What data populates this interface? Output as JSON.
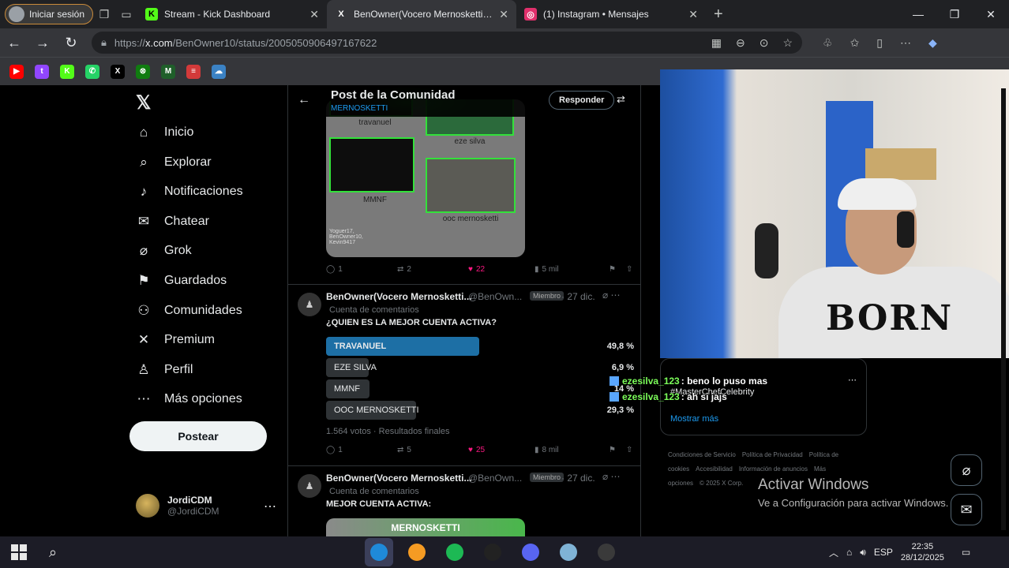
{
  "browser": {
    "profile_label": "Iniciar sesión",
    "tabs": [
      {
        "title": "Stream - Kick Dashboard",
        "icon": "kick-icon",
        "color": "#53fc18"
      },
      {
        "title": "BenOwner(Vocero Mernoskettista)",
        "icon": "x-icon",
        "color": "#000000"
      },
      {
        "title": "(1) Instagram • Mensajes",
        "icon": "instagram-icon",
        "color": "#e1306c"
      }
    ],
    "url_prefix": "https://",
    "url_host": "x.com",
    "url_path": "/BenOwner10/status/2005050906497167622",
    "bookmarks": [
      {
        "icon": "youtube-icon",
        "glyph": "▶",
        "color": "#ff0000"
      },
      {
        "icon": "twitch-icon",
        "glyph": "t",
        "color": "#9146ff"
      },
      {
        "icon": "kick-icon",
        "glyph": "K",
        "color": "#53fc18"
      },
      {
        "icon": "whatsapp-icon",
        "glyph": "✆",
        "color": "#25d366"
      },
      {
        "icon": "x-icon",
        "glyph": "X",
        "color": "#000000"
      },
      {
        "icon": "xbox-icon",
        "glyph": "⊗",
        "color": "#107c10"
      },
      {
        "icon": "m-icon",
        "glyph": "M",
        "color": "#1f5f2a"
      },
      {
        "icon": "stack-icon",
        "glyph": "≡",
        "color": "#d33a3a"
      },
      {
        "icon": "cloud-icon",
        "glyph": "☁",
        "color": "#3b82c4"
      }
    ]
  },
  "sidebar": {
    "items": [
      {
        "label": "Inicio",
        "icon": "home-icon",
        "glyph": "⌂"
      },
      {
        "label": "Explorar",
        "icon": "search-icon",
        "glyph": "⌕"
      },
      {
        "label": "Notificaciones",
        "icon": "bell-icon",
        "glyph": "♪"
      },
      {
        "label": "Chatear",
        "icon": "mail-icon",
        "glyph": "✉"
      },
      {
        "label": "Grok",
        "icon": "grok-icon",
        "glyph": "⌀"
      },
      {
        "label": "Guardados",
        "icon": "bookmark-icon",
        "glyph": "⚑"
      },
      {
        "label": "Comunidades",
        "icon": "communities-icon",
        "glyph": "⚇"
      },
      {
        "label": "Premium",
        "icon": "x-premium-icon",
        "glyph": "✕"
      },
      {
        "label": "Perfil",
        "icon": "person-icon",
        "glyph": "♙"
      },
      {
        "label": "Más opciones",
        "icon": "more-circle-icon",
        "glyph": "⋯"
      }
    ],
    "post_button": "Postear",
    "account_name": "JordiCDM",
    "account_handle": "@JordiCDM"
  },
  "header": {
    "title": "Post de la Comunidad",
    "subtitle": "MERNOSKETTI",
    "reply_button": "Responder"
  },
  "collage": {
    "captions": [
      "travanuel",
      "eze silva",
      "MMNF",
      "ooc mernosketti"
    ],
    "small_text": "Yoguer17, BenOwner10, Kevin9417"
  },
  "post1_actions": {
    "replies": "1",
    "reposts": "2",
    "likes": "22",
    "views": "5 mil"
  },
  "tweet1": {
    "name": "BenOwner(Vocero Mernosketti...",
    "handle": "@BenOwn...",
    "badge": "Miembro",
    "date": "· 27 dic.",
    "context": "Cuenta de comentarios",
    "text": "¿QUIEN ES LA MEJOR CUENTA ACTIVA?",
    "poll": [
      {
        "label": "TRAVANUEL",
        "pct": "49,8 %",
        "share": 0.498,
        "winner": true
      },
      {
        "label": "EZE SILVA",
        "pct": "6,9 %",
        "share": 0.069,
        "winner": false
      },
      {
        "label": "MMNF",
        "pct": "14 %",
        "share": 0.14,
        "winner": false
      },
      {
        "label": "OOC MERNOSKETTI",
        "pct": "29,3 %",
        "share": 0.293,
        "winner": false
      }
    ],
    "poll_meta": "1.564 votos · Resultados finales",
    "actions": {
      "replies": "1",
      "reposts": "5",
      "likes": "25",
      "views": "8 mil"
    }
  },
  "tweet2": {
    "name": "BenOwner(Vocero Mernosketti...",
    "handle": "@BenOwn...",
    "badge": "Miembro",
    "date": "· 27 dic.",
    "context": "Cuenta de comentarios",
    "text": "MEJOR CUENTA ACTIVA:",
    "media_label": "MERNOSKETTI"
  },
  "trend": {
    "tag": "#MasterChefCelebrity",
    "more": "Mostrar más"
  },
  "footer_links": [
    "Condiciones de Servicio",
    "Política de Privacidad",
    "Política de cookies",
    "Accesibilidad",
    "Información de anuncios",
    "Más opciones",
    "© 2025 X Corp."
  ],
  "chat": [
    {
      "user": "ezesilva_123",
      "message": ": beno lo puso mas"
    },
    {
      "user": "ezesilva_123",
      "message": ": ah si jajs"
    }
  ],
  "watermark": {
    "title": "Activar Windows",
    "subtitle": "Ve a Configuración para activar Windows."
  },
  "taskbar": {
    "apps": [
      {
        "icon": "edge-icon",
        "color": "#1f8ad9",
        "active": true
      },
      {
        "icon": "fl-studio-icon",
        "color": "#f59b23",
        "active": false
      },
      {
        "icon": "spotify-icon",
        "color": "#1db954",
        "active": false
      },
      {
        "icon": "xsplit-icon",
        "color": "#222222",
        "active": false
      },
      {
        "icon": "discord-icon",
        "color": "#5865f2",
        "active": false
      },
      {
        "icon": "notepad-icon",
        "color": "#7fb3d5",
        "active": false
      },
      {
        "icon": "obs-icon",
        "color": "#3a3a3a",
        "active": false
      }
    ],
    "language": "ESP",
    "time": "22:35",
    "date": "28/12/2025"
  }
}
